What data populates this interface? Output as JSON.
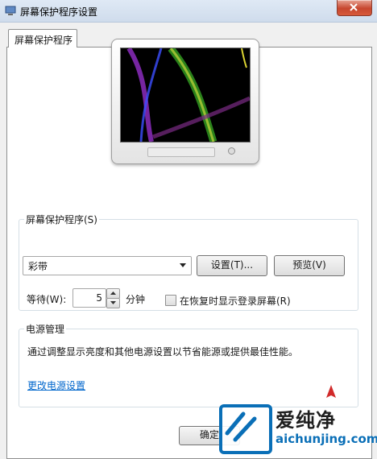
{
  "window": {
    "title": "屏幕保护程序设置"
  },
  "tabs": [
    {
      "label": "屏幕保护程序",
      "selected": true
    }
  ],
  "screensaver": {
    "group_label": "屏幕保护程序(S)",
    "selected": "彩带",
    "settings_button": "设置(T)...",
    "preview_button": "预览(V)",
    "wait_label": "等待(W):",
    "wait_value": "5",
    "minutes_label": "分钟",
    "resume_checkbox_label": "在恢复时显示登录屏幕(R)",
    "resume_checked": false
  },
  "power": {
    "group_label": "电源管理",
    "description": "通过调整显示亮度和其他电源设置以节省能源或提供最佳性能。",
    "link": "更改电源设置"
  },
  "footer": {
    "ok_button": "确定"
  },
  "watermark": {
    "title": "爱纯净",
    "url": "aichunjing.com"
  },
  "colors": {
    "link": "#0066cc",
    "close_button": "#c7472f",
    "watermark_blue": "#0a6fb7"
  }
}
